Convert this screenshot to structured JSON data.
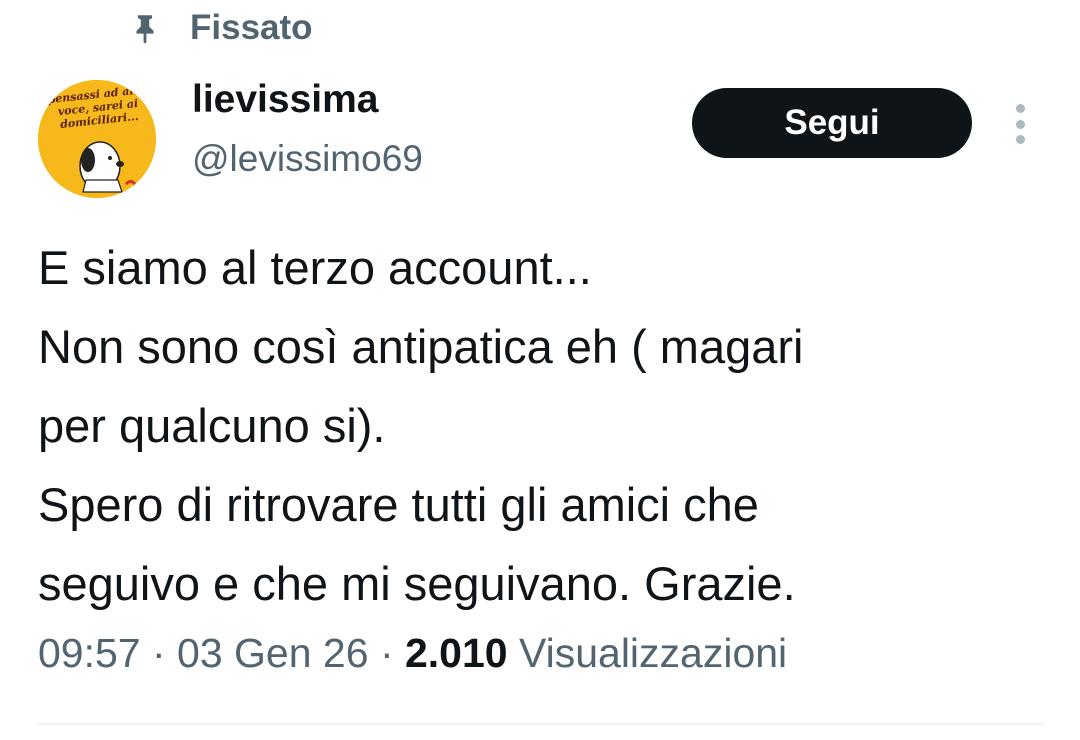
{
  "pinned": {
    "label": "Fissato",
    "icon": "pin-icon"
  },
  "author": {
    "display_name": "lievissima",
    "handle": "@levissimo69",
    "avatar_text": [
      "pensassi ad alta",
      "voce, sarei ai",
      "domiciliari..."
    ]
  },
  "actions": {
    "follow_label": "Segui",
    "more_icon": "more-vertical-icon"
  },
  "tweet": {
    "lines": [
      "E siamo al terzo account...",
      "Non sono così antipatica eh ( magari",
      "per qualcuno si).",
      "Spero di ritrovare tutti gli amici che",
      "seguivo e che mi seguivano. Grazie."
    ]
  },
  "meta": {
    "time": "09:57",
    "separator": " · ",
    "date": "03 Gen 26",
    "views_count": "2.010",
    "views_label": "Visualizzazioni"
  },
  "colors": {
    "text_primary": "#0f1419",
    "text_secondary": "#536471",
    "button_bg": "#0f1419",
    "avatar_bg": "#f6b81a"
  }
}
